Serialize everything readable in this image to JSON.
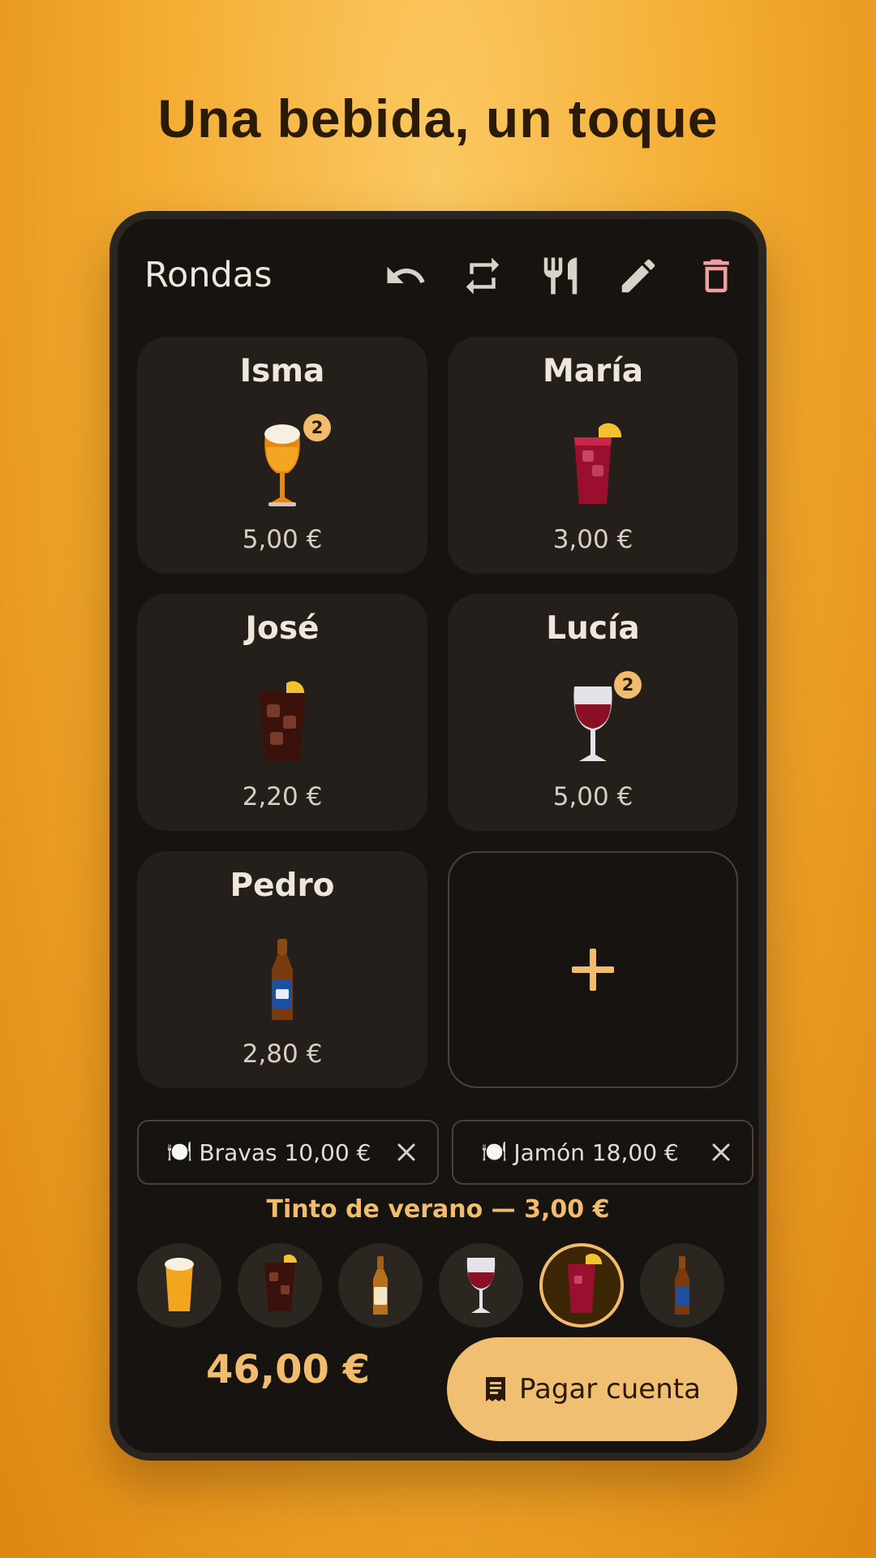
{
  "headline": "Una bebida, un toque",
  "app": {
    "title": "Rondas",
    "toolbar": {
      "undo_icon": "undo-icon",
      "repeat_icon": "repeat-icon",
      "food_icon": "fork-knife-icon",
      "edit_icon": "pencil-icon",
      "delete_icon": "trash-icon",
      "delete_color": "#f0a0a0"
    }
  },
  "people": [
    {
      "name": "Isma",
      "drink": "beer-glass",
      "count": "2",
      "price": "5,00 €"
    },
    {
      "name": "María",
      "drink": "tinto-de-verano",
      "count": "",
      "price": "3,00 €"
    },
    {
      "name": "José",
      "drink": "cola",
      "count": "",
      "price": "2,20 €"
    },
    {
      "name": "Lucía",
      "drink": "red-wine",
      "count": "2",
      "price": "5,00 €"
    },
    {
      "name": "Pedro",
      "drink": "beer-0-0-bottle",
      "count": "",
      "price": "2,80 €"
    }
  ],
  "food_items": [
    {
      "icon": "🍽️",
      "label": "Bravas 10,00 €"
    },
    {
      "icon": "🍽️",
      "label": "Jamón 18,00 €"
    }
  ],
  "selected_drink_label": "Tinto de verano — 3,00 €",
  "drink_picker": [
    "caña",
    "cola",
    "bottled-beer",
    "red-wine",
    "tinto-de-verano",
    "beer-0-0-bottle"
  ],
  "selected_drink_index": 4,
  "total": "46,00 €",
  "pay_button": "Pagar cuenta",
  "colors": {
    "accent": "#f1bc6c",
    "card": "#241f1b",
    "background": "#161310"
  }
}
